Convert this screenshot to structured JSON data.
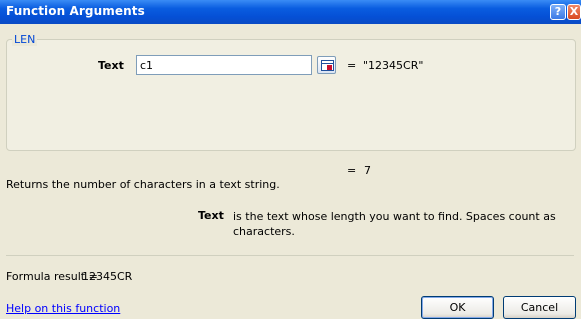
{
  "window": {
    "title": "Function Arguments",
    "help_glyph": "?",
    "close_glyph": "X"
  },
  "function": {
    "name": "LEN",
    "argument_label": "Text",
    "argument_value": "c1",
    "argument_eq": "=",
    "argument_result": "\"12345CR\"",
    "result_eq": "=",
    "result_value": "7",
    "description": "Returns the number of characters in a text string.",
    "help_label": "Text",
    "help_text": "is the text whose length you want to find. Spaces count as characters."
  },
  "formula": {
    "label": "Formula result =",
    "value": "12345CR"
  },
  "links": {
    "help": "Help on this function"
  },
  "buttons": {
    "ok": "OK",
    "cancel": "Cancel"
  },
  "colors": {
    "titlebar": "#0a5de0",
    "dialog_bg": "#ece9d8",
    "group_bg": "#f1efe2",
    "legend": "#0046d5",
    "link": "#0000ff"
  },
  "icons": {
    "ref_button": "collapse-dialog-icon"
  }
}
